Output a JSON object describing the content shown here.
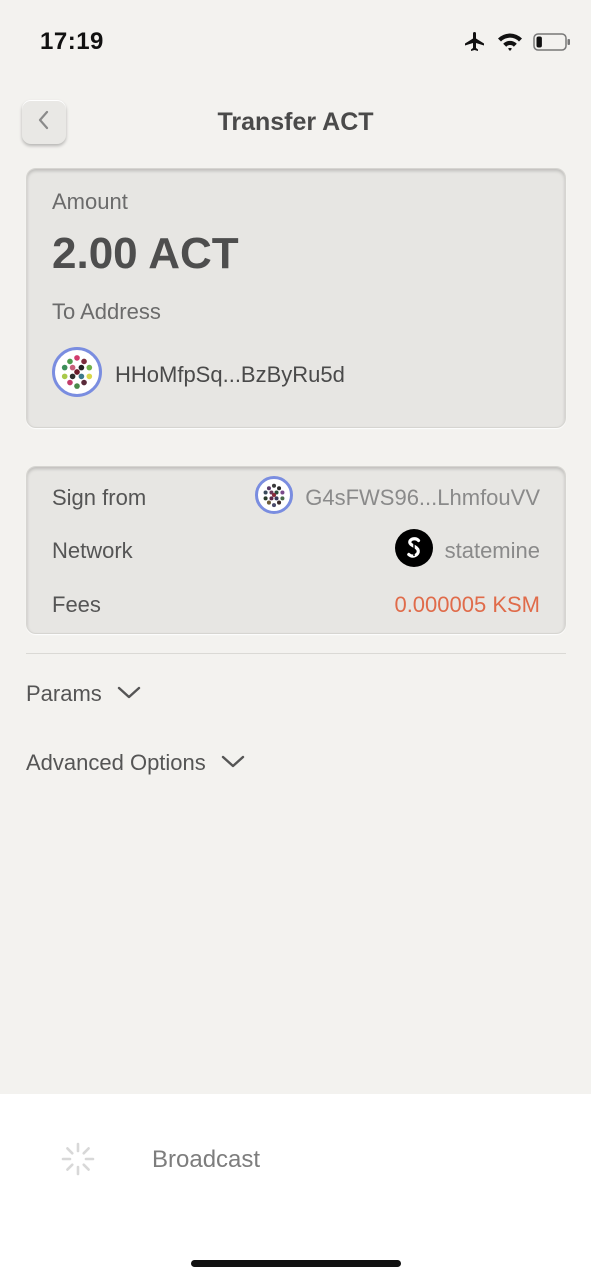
{
  "status_bar": {
    "time": "17:19",
    "icons": [
      "airplane-icon",
      "wifi-icon",
      "battery-icon"
    ],
    "battery_level": 0.2
  },
  "header": {
    "title": "Transfer ACT",
    "back_icon": "chevron-left-icon"
  },
  "amount_card": {
    "amount_label": "Amount",
    "amount_value": "2.00 ACT",
    "to_label": "To Address",
    "to_address": "HHoMfpSq...BzByRu5d"
  },
  "details": {
    "sign_from_label": "Sign from",
    "sign_from_value": "G4sFWS96...LhmfouVV",
    "network_label": "Network",
    "network_value": "statemine",
    "fees_label": "Fees",
    "fees_value": "0.000005 KSM"
  },
  "sections": {
    "params_label": "Params",
    "advanced_label": "Advanced Options"
  },
  "footer": {
    "broadcast_label": "Broadcast"
  },
  "colors": {
    "background": "#f3f2ef",
    "card": "#e7e6e3",
    "fees": "#e06b4a",
    "identicon_ring": "#7a8de0"
  }
}
